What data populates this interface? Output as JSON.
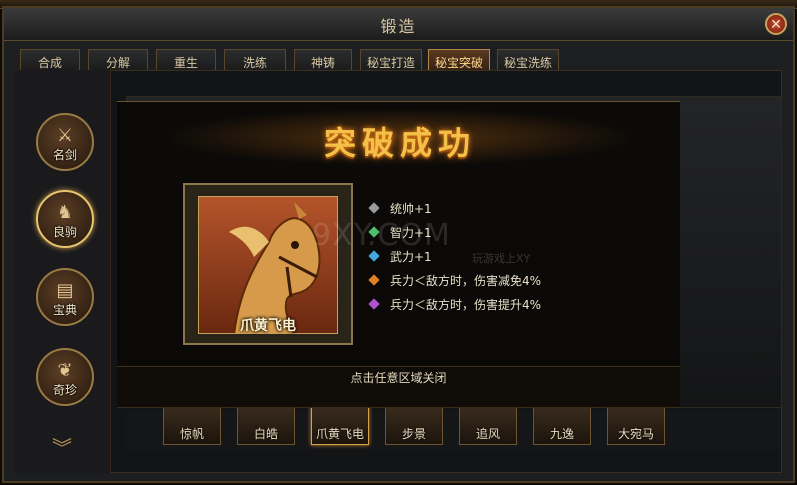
{
  "window": {
    "title": "锻造",
    "close_glyph": "✕"
  },
  "tabs": [
    {
      "label": "合成"
    },
    {
      "label": "分解"
    },
    {
      "label": "重生"
    },
    {
      "label": "洗练"
    },
    {
      "label": "神铸"
    },
    {
      "label": "秘宝打造"
    },
    {
      "label": "秘宝突破"
    },
    {
      "label": "秘宝洗练"
    }
  ],
  "active_tab": "秘宝突破",
  "sidebar": {
    "items": [
      {
        "label": "名剑",
        "icon": "sword-icon"
      },
      {
        "label": "良驹",
        "icon": "horse-icon"
      },
      {
        "label": "宝典",
        "icon": "book-icon"
      },
      {
        "label": "奇珍",
        "icon": "treasure-icon"
      }
    ],
    "active": "良驹",
    "more_glyph": "︾"
  },
  "horses": [
    {
      "label": "惊帆"
    },
    {
      "label": "白皓"
    },
    {
      "label": "爪黄飞电"
    },
    {
      "label": "步景"
    },
    {
      "label": "追风"
    },
    {
      "label": "九逸"
    },
    {
      "label": "大宛马"
    }
  ],
  "selected_horse": "爪黄飞电",
  "popup": {
    "banner": "突破成功",
    "item_name": "爪黄飞电",
    "stats": [
      {
        "text": "统帅+1",
        "gem_color": "#9a9a9a"
      },
      {
        "text": "智力+1",
        "gem_color": "#4fc06a"
      },
      {
        "text": "武力+1",
        "gem_color": "#44a8e0"
      },
      {
        "text": "兵力＜敌方时，伤害减免4%",
        "gem_color": "#e0801e"
      },
      {
        "text": "兵力＜敌方时，伤害提升4%",
        "gem_color": "#b050d0"
      }
    ],
    "close_hint": "点击任意区域关闭"
  },
  "watermark": {
    "main": "9XY.COM",
    "sub": "玩游戏上XY"
  }
}
